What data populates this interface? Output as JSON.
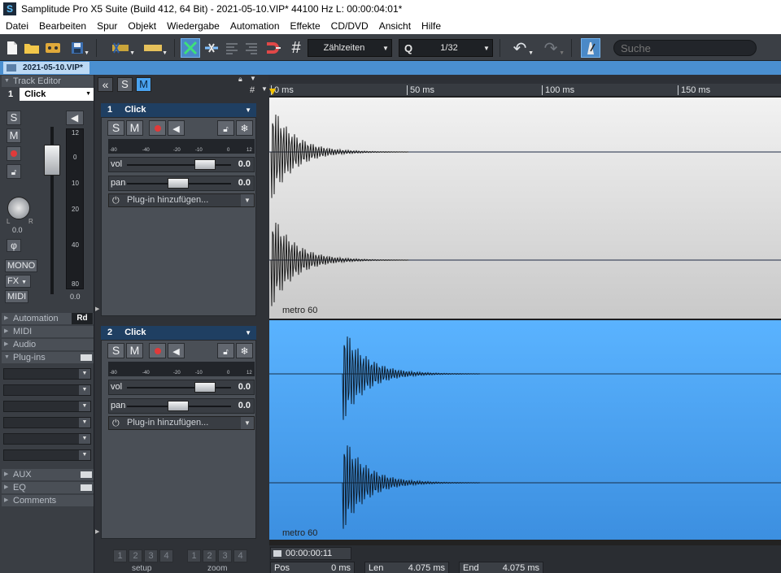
{
  "window": {
    "title": "Samplitude Pro X5 Suite (Build 412, 64 Bit)  -  2021-05-10.VIP*   44100 Hz L: 00:00:04:01*"
  },
  "menu": [
    "Datei",
    "Bearbeiten",
    "Spur",
    "Objekt",
    "Wiedergabe",
    "Automation",
    "Effekte",
    "CD/DVD",
    "Ansicht",
    "Hilfe"
  ],
  "toolbar": {
    "grid_mode": "Zählzeiten",
    "quantize_label": "Q",
    "quantize_value": "1/32",
    "search_placeholder": "Suche"
  },
  "project_tab": "2021-05-10.VIP*",
  "left_panel": {
    "header": "Track Editor",
    "track_number": "1",
    "track_name": "Click",
    "s_label": "S",
    "m_label": "M",
    "pan_value": "0.0",
    "mono_label": "MONO",
    "fx_label": "FX",
    "midi_label": "MIDI",
    "phase_symbol": "φ",
    "meter_scale": [
      "12",
      "0",
      "10",
      "20",
      "40",
      "80"
    ],
    "meter_value": "0.0",
    "sections": [
      "Automation",
      "MIDI",
      "Audio",
      "Plug-ins"
    ],
    "automation_mode": "Rd",
    "lower_sections": [
      "AUX",
      "EQ",
      "Comments"
    ]
  },
  "mixer_header": {
    "collapse": "«",
    "s": "S",
    "m": "M"
  },
  "tracks": [
    {
      "number": "1",
      "name": "Click",
      "s": "S",
      "m": "M",
      "vol_label": "vol",
      "vol_value": "0.0",
      "pan_label": "pan",
      "pan_value": "0.0",
      "plugin_label": "Plug-in hinzufügen...",
      "meter_scale": [
        "-80",
        "-40",
        "-20",
        "-10",
        "0",
        "12"
      ],
      "object_name": "metro 60"
    },
    {
      "number": "2",
      "name": "Click",
      "s": "S",
      "m": "M",
      "vol_label": "vol",
      "vol_value": "0.0",
      "pan_label": "pan",
      "pan_value": "0.0",
      "plugin_label": "Plug-in hinzufügen...",
      "meter_scale": [
        "-80",
        "-40",
        "-20",
        "-10",
        "0",
        "12"
      ],
      "object_name": "metro 60"
    }
  ],
  "ruler": [
    "0 ms",
    "50 ms",
    "100 ms",
    "150 ms"
  ],
  "transport": {
    "time": "00:00:00:11",
    "pos_label": "Pos",
    "pos_value": "0 ms",
    "len_label": "Len",
    "len_value": "4.075 ms",
    "end_label": "End",
    "end_value": "4.075 ms"
  },
  "bottom": {
    "setup_label": "setup",
    "zoom_label": "zoom",
    "setup_buttons": [
      "1",
      "2",
      "3",
      "4"
    ],
    "zoom_buttons": [
      "1",
      "2",
      "3",
      "4"
    ]
  },
  "colors": {
    "track1_bg": "#d8d8d8",
    "track2_bg": "#4aa3f0",
    "track_header": "#1f3f62",
    "tab_bar": "#4a8fd0"
  }
}
